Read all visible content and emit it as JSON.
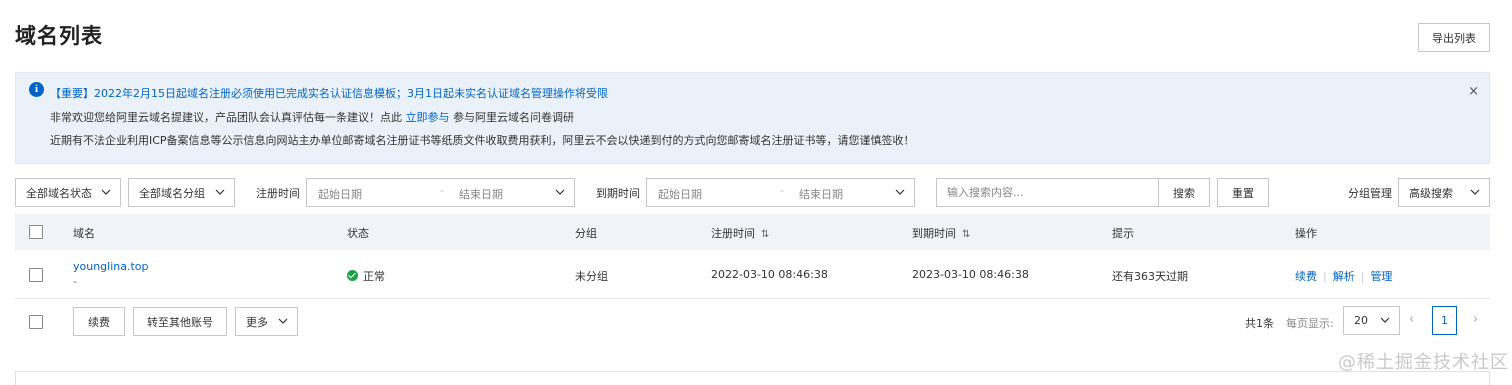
{
  "page": {
    "title": "域名列表",
    "export_label": "导出列表"
  },
  "notice": {
    "line1": "【重要】2022年2月15日起域名注册必须使用已完成实名认证信息模板；3月1日起未实名认证域名管理操作将受限",
    "line2_before": "非常欢迎您给阿里云域名提建议，产品团队会认真评估每一条建议！点此",
    "line2_link": "立即参与",
    "line2_after": "参与阿里云域名问卷调研",
    "line3": "近期有不法企业利用ICP备案信息等公示信息向网站主办单位邮寄域名注册证书等纸质文件收取费用获利，阿里云不会以快递到付的方式向您邮寄域名注册证书等，请您谨慎签收！",
    "close_glyph": "×"
  },
  "filters": {
    "status_select": "全部域名状态",
    "group_select": "全部域名分组",
    "reg_time_label": "注册时间",
    "exp_time_label": "到期时间",
    "start_placeholder": "起始日期",
    "end_placeholder": "结束日期",
    "range_sep": "-",
    "search_placeholder": "输入搜索内容...",
    "search_button": "搜索",
    "reset_button": "重置",
    "group_manage": "分组管理",
    "advanced_search": "高级搜索"
  },
  "table": {
    "columns": {
      "domain": "域名",
      "status": "状态",
      "group": "分组",
      "reg_time": "注册时间",
      "exp_time": "到期时间",
      "hint": "提示",
      "actions": "操作"
    },
    "rows": [
      {
        "domain": "younglina.top",
        "sub": "-",
        "status": "正常",
        "group": "未分组",
        "reg_time": "2022-03-10 08:46:38",
        "exp_time": "2023-03-10 08:46:38",
        "hint": "还有363天过期",
        "actions": [
          "续费",
          "解析",
          "管理"
        ]
      }
    ]
  },
  "footer": {
    "renew_button": "续费",
    "transfer_button": "转至其他账号",
    "more_select": "更多",
    "total": "共1条",
    "per_page_label": "每页显示:",
    "per_page_value": "20",
    "current_page": "1",
    "prev_glyph": "‹",
    "next_glyph": "›"
  },
  "watermark": "@稀土掘金技术社区",
  "colors": {
    "link": "#0064c8",
    "notice_bg": "#ebf1f8",
    "status_ok": "#1e9f46",
    "table_header_bg": "#f0f3f7"
  }
}
